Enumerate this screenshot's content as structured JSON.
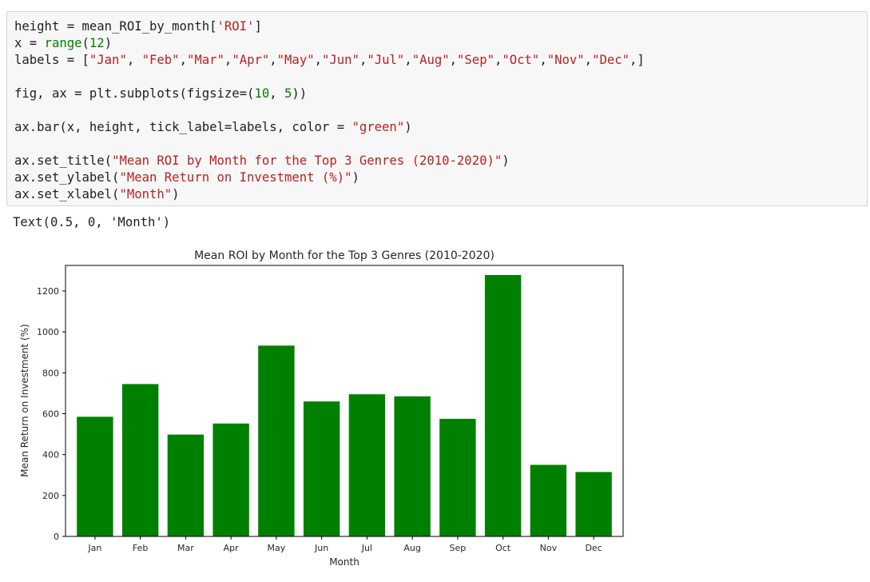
{
  "code_cell": {
    "lines": [
      [
        {
          "t": "height = mean_ROI_by_month[",
          "c": ""
        },
        {
          "t": "'ROI'",
          "c": "str"
        },
        {
          "t": "]",
          "c": ""
        }
      ],
      [
        {
          "t": "x = ",
          "c": ""
        },
        {
          "t": "range",
          "c": "builtin"
        },
        {
          "t": "(",
          "c": ""
        },
        {
          "t": "12",
          "c": "num"
        },
        {
          "t": ")",
          "c": ""
        }
      ],
      [
        {
          "t": "labels = [",
          "c": ""
        },
        {
          "t": "\"Jan\"",
          "c": "str"
        },
        {
          "t": ", ",
          "c": ""
        },
        {
          "t": "\"Feb\"",
          "c": "str"
        },
        {
          "t": ",",
          "c": ""
        },
        {
          "t": "\"Mar\"",
          "c": "str"
        },
        {
          "t": ",",
          "c": ""
        },
        {
          "t": "\"Apr\"",
          "c": "str"
        },
        {
          "t": ",",
          "c": ""
        },
        {
          "t": "\"May\"",
          "c": "str"
        },
        {
          "t": ",",
          "c": ""
        },
        {
          "t": "\"Jun\"",
          "c": "str"
        },
        {
          "t": ",",
          "c": ""
        },
        {
          "t": "\"Jul\"",
          "c": "str"
        },
        {
          "t": ",",
          "c": ""
        },
        {
          "t": "\"Aug\"",
          "c": "str"
        },
        {
          "t": ",",
          "c": ""
        },
        {
          "t": "\"Sep\"",
          "c": "str"
        },
        {
          "t": ",",
          "c": ""
        },
        {
          "t": "\"Oct\"",
          "c": "str"
        },
        {
          "t": ",",
          "c": ""
        },
        {
          "t": "\"Nov\"",
          "c": "str"
        },
        {
          "t": ",",
          "c": ""
        },
        {
          "t": "\"Dec\"",
          "c": "str"
        },
        {
          "t": ",]",
          "c": ""
        }
      ],
      [
        {
          "t": "",
          "c": ""
        }
      ],
      [
        {
          "t": "fig, ax = plt.subplots(figsize=(",
          "c": ""
        },
        {
          "t": "10",
          "c": "num"
        },
        {
          "t": ", ",
          "c": ""
        },
        {
          "t": "5",
          "c": "num"
        },
        {
          "t": "))",
          "c": ""
        }
      ],
      [
        {
          "t": "",
          "c": ""
        }
      ],
      [
        {
          "t": "ax.bar(x, height, tick_label=labels, color = ",
          "c": ""
        },
        {
          "t": "\"green\"",
          "c": "str"
        },
        {
          "t": ")",
          "c": ""
        }
      ],
      [
        {
          "t": "",
          "c": ""
        }
      ],
      [
        {
          "t": "ax.set_title(",
          "c": ""
        },
        {
          "t": "\"Mean ROI by Month for the Top 3 Genres (2010-2020)\"",
          "c": "str"
        },
        {
          "t": ")",
          "c": ""
        }
      ],
      [
        {
          "t": "ax.set_ylabel(",
          "c": ""
        },
        {
          "t": "\"Mean Return on Investment (%)\"",
          "c": "str"
        },
        {
          "t": ")",
          "c": ""
        }
      ],
      [
        {
          "t": "ax.set_xlabel(",
          "c": ""
        },
        {
          "t": "\"Month\"",
          "c": "str"
        },
        {
          "t": ")",
          "c": ""
        }
      ]
    ]
  },
  "output_text": "Text(0.5, 0, 'Month')",
  "chart_data": {
    "type": "bar",
    "title": "Mean ROI by Month for the Top 3 Genres (2010-2020)",
    "xlabel": "Month",
    "ylabel": "Mean Return on Investment (%)",
    "categories": [
      "Jan",
      "Feb",
      "Mar",
      "Apr",
      "May",
      "Jun",
      "Jul",
      "Aug",
      "Sep",
      "Oct",
      "Nov",
      "Dec"
    ],
    "values": [
      585,
      745,
      498,
      552,
      933,
      660,
      695,
      685,
      575,
      1278,
      350,
      315
    ],
    "ylim": [
      0,
      1325
    ],
    "yticks": [
      0,
      200,
      400,
      600,
      800,
      1000,
      1200
    ],
    "color": "#008000",
    "grid": false
  }
}
